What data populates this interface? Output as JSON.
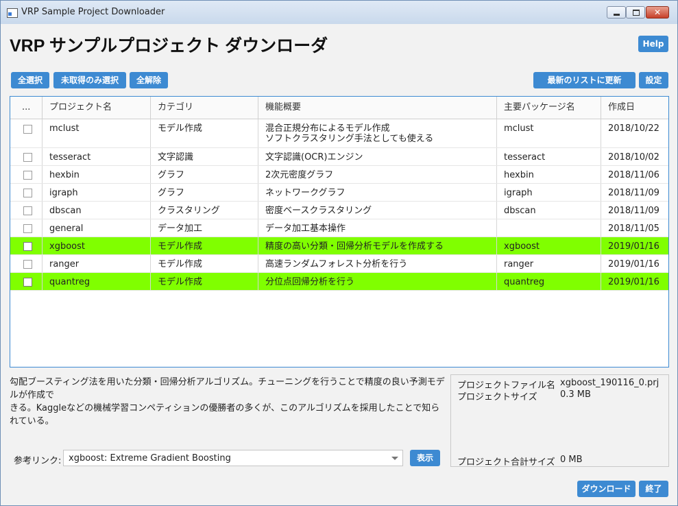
{
  "window": {
    "title": "VRP Sample Project Downloader",
    "close_glyph": "✕"
  },
  "header": {
    "title": "VRP サンプルプロジェクト ダウンローダ",
    "help_label": "Help"
  },
  "toolbar": {
    "select_all": "全選択",
    "select_unacquired": "未取得のみ選択",
    "deselect_all": "全解除",
    "refresh": "最新のリストに更新",
    "settings": "設定"
  },
  "table": {
    "columns": [
      "...",
      "プロジェクト名",
      "カテゴリ",
      "機能概要",
      "主要パッケージ名",
      "作成日"
    ],
    "rows": [
      {
        "name": "mclust",
        "category": "モデル作成",
        "summary_line1": "混合正規分布によるモデル作成",
        "summary_line2": "ソフトクラスタリング手法としても使える",
        "package": "mclust",
        "date": "2018/10/22",
        "highlight": false
      },
      {
        "name": "tesseract",
        "category": "文字認識",
        "summary_line1": "文字認識(OCR)エンジン",
        "summary_line2": "",
        "package": "tesseract",
        "date": "2018/10/02",
        "highlight": false
      },
      {
        "name": "hexbin",
        "category": "グラフ",
        "summary_line1": "2次元密度グラフ",
        "summary_line2": "",
        "package": "hexbin",
        "date": "2018/11/06",
        "highlight": false
      },
      {
        "name": "igraph",
        "category": "グラフ",
        "summary_line1": "ネットワークグラフ",
        "summary_line2": "",
        "package": "igraph",
        "date": "2018/11/09",
        "highlight": false
      },
      {
        "name": "dbscan",
        "category": "クラスタリング",
        "summary_line1": "密度ベースクラスタリング",
        "summary_line2": "",
        "package": "dbscan",
        "date": "2018/11/09",
        "highlight": false
      },
      {
        "name": "general",
        "category": "データ加工",
        "summary_line1": "データ加工基本操作",
        "summary_line2": "",
        "package": "",
        "date": "2018/11/05",
        "highlight": false
      },
      {
        "name": "xgboost",
        "category": "モデル作成",
        "summary_line1": "精度の高い分類・回帰分析モデルを作成する",
        "summary_line2": "",
        "package": "xgboost",
        "date": "2019/01/16",
        "highlight": true
      },
      {
        "name": "ranger",
        "category": "モデル作成",
        "summary_line1": "高速ランダムフォレスト分析を行う",
        "summary_line2": "",
        "package": "ranger",
        "date": "2019/01/16",
        "highlight": false
      },
      {
        "name": "quantreg",
        "category": "モデル作成",
        "summary_line1": "分位点回帰分析を行う",
        "summary_line2": "",
        "package": "quantreg",
        "date": "2019/01/16",
        "highlight": true
      }
    ]
  },
  "details": {
    "description_line1": "勾配ブースティング法を用いた分類・回帰分析アルゴリズム。チューニングを行うことで精度の良い予測モデルが作成で",
    "description_line2": "きる。Kaggleなどの機械学習コンペティションの優勝者の多くが、このアルゴリズムを採用したことで知られている。",
    "ref_label": "参考リンク:",
    "ref_value": "xgboost: Extreme Gradient Boosting",
    "show_label": "表示"
  },
  "info": {
    "file_name_label": "プロジェクトファイル名",
    "file_name_value": "xgboost_190116_0.prj",
    "size_label": "プロジェクトサイズ",
    "size_value": "0.3 MB",
    "total_label": "プロジェクト合計サイズ",
    "total_value": "0 MB"
  },
  "footer": {
    "download_label": "ダウンロード",
    "exit_label": "終了"
  },
  "colors": {
    "accent": "#3d8ad2",
    "highlight": "#80ff00"
  }
}
